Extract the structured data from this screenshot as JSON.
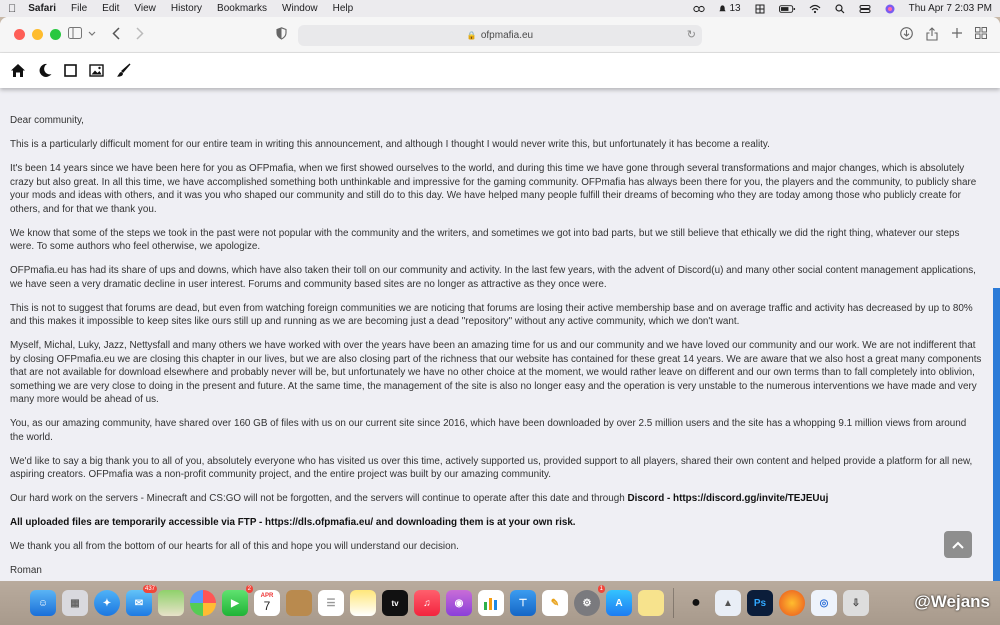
{
  "menubar": {
    "app": "Safari",
    "items": [
      "File",
      "Edit",
      "View",
      "History",
      "Bookmarks",
      "Window",
      "Help"
    ],
    "status_count": "13",
    "datetime": "Thu Apr 7  2:03 PM"
  },
  "browser": {
    "url": "ofpmafia.eu"
  },
  "site_nav": {
    "icons": [
      "home-icon",
      "moon-icon",
      "square-icon",
      "image-icon",
      "brush-icon"
    ]
  },
  "article": {
    "p1": "Dear community,",
    "p2": "This is a particularly difficult moment for our entire team in writing this announcement, and although I thought I would never write this, but unfortunately it has become a reality.",
    "p3": "It's been 14 years since we have been here for you as OFPmafia, when we first showed ourselves to the world, and during this time we have gone through several transformations and major changes, which is absolutely crazy but also great. In all this time, we have accomplished something both unthinkable and impressive for the gaming community. OFPmafia has always been there for you, the players and the community, to publicly share your mods and ideas with others, and it was you who shaped our community and still do to this day. We have helped many people fulfill their dreams of becoming who they are today among those who publicly create for others, and for that we thank you.",
    "p4": "We know that some of the steps we took in the past were not popular with the community and the writers, and sometimes we got into bad parts, but we still believe that ethically we did the right thing, whatever our steps were. To some authors who feel otherwise, we apologize.",
    "p5": "OFPmafia.eu has had its share of ups and downs, which have also taken their toll on our community and activity. In the last few years, with the advent of Discord(u) and many other social content management applications, we have seen a very dramatic decline in user interest. Forums and community based sites are no longer as attractive as they once were.",
    "p6": "This is not to suggest that forums are dead, but even from watching foreign communities we are noticing that forums are losing their active membership base and on average traffic and activity has decreased by up to 80% and this makes it impossible to keep sites like ours still up and running as we are becoming just a dead \"repository\" without any active community, which we don't want.",
    "p7": "Myself, Michal, Luky, Jazz, Nettysfall and many others we have worked with over the years have been an amazing time for us and our community and we have loved our community and our work. We are not indifferent that by closing OFPmafia.eu we are closing this chapter in our lives, but we are also closing part of the richness that our website has contained for these great 14 years. We are aware that we also host a great many components that are not available for download elsewhere and probably never will be, but unfortunately we have no other choice at the moment, we would rather leave on different and our own terms than to fall completely into oblivion, something we are very close to doing in the present and future. At the same time, the management of the site is also no longer easy and the operation is very unstable to the numerous interventions we have made and very many more would be ahead of us.",
    "p8": "You, as our amazing community, have shared over 160 GB of files with us on our current site since 2016, which have been downloaded by over 2.5 million users and the site has a whopping 9.1 million views from around the world.",
    "p9": "We'd like to say a big thank you to all of you, absolutely everyone who has visited us over this time, actively supported us, provided support to all players, shared their own content and helped provide a platform for all new, aspiring creators. OFPmafia was a non-profit community project, and the entire project was built by our amazing community.",
    "p10_text": "Our hard work on the servers - Minecraft and CS:GO will not be forgotten, and the servers will continue to operate after this date and through ",
    "p10_bold": "Discord - https://discord.gg/invite/TEJEUuj",
    "p11": "All uploaded files are temporarily accessible via FTP - https://dls.ofpmafia.eu/ and downloading them is at your own risk.",
    "p12": "We thank you all from the bottom of our hearts for all of this and hope you will understand our decision.",
    "p13": "Roman"
  },
  "dock": {
    "badges": {
      "mail": "437",
      "facetime": "2",
      "appstore": "1"
    },
    "calendar_month": "APR",
    "calendar_day": "7",
    "watermark": "@Wejans"
  },
  "colors": {
    "scroll_accent": "#2b7bd8",
    "page_bg": "#efeff4"
  }
}
